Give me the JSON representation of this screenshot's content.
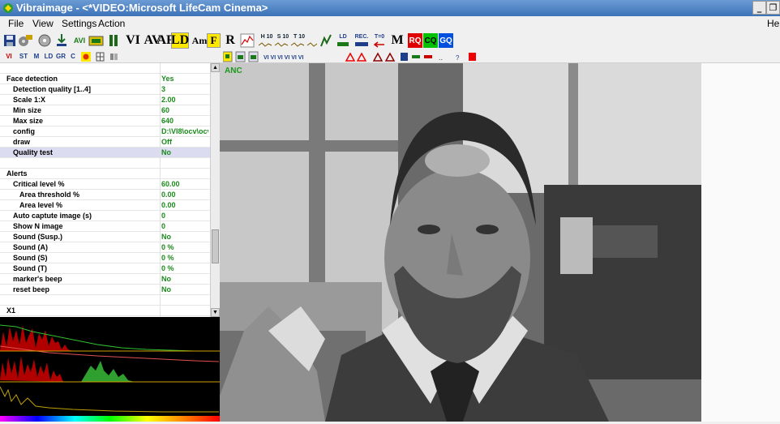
{
  "window": {
    "title": "Vibraimage - <*VIDEO:Microsoft LifeCam Cinema>",
    "minimize_glyph": "_",
    "restore_glyph": "❐"
  },
  "menu": {
    "items": [
      "File",
      "View",
      "Settings",
      "Action"
    ],
    "help": "Hel"
  },
  "toolbar1": {
    "avi": "AVI",
    "vi": "VI",
    "av": "AV",
    "ar": "AR",
    "ld": "LD",
    "am": "Am",
    "f": "F",
    "r": "R",
    "h10": "H 10",
    "s10": "S 10",
    "t10": "T 10",
    "ld_small": "LD",
    "rec": "REC.",
    "t0": "T=0",
    "m": "M",
    "rq": "RQ",
    "cq": "CQ",
    "gq": "GQ"
  },
  "toolbar2": {
    "vi": "VI",
    "st": "ST",
    "m": "M",
    "ld": "LD",
    "gr": "GR",
    "c": "C"
  },
  "settings": {
    "rows": [
      {
        "name": "",
        "value": "",
        "indent": 0
      },
      {
        "name": "Face detection",
        "value": "Yes",
        "indent": 0
      },
      {
        "name": "Detection quality [1..4]",
        "value": "3",
        "indent": 1
      },
      {
        "name": "Scale 1:X",
        "value": "2.00",
        "indent": 1
      },
      {
        "name": "Min size",
        "value": "60",
        "indent": 1
      },
      {
        "name": "Max size",
        "value": "640",
        "indent": 1
      },
      {
        "name": "config",
        "value": "D:\\VI8\\ocv\\ocv_",
        "indent": 1
      },
      {
        "name": "draw",
        "value": "Off",
        "indent": 1
      },
      {
        "name": "Quality test",
        "value": "No",
        "indent": 1,
        "selected": true
      },
      {
        "name": "",
        "value": "",
        "indent": 0
      },
      {
        "name": "Alerts",
        "value": "",
        "indent": 0
      },
      {
        "name": "Critical level %",
        "value": "60.00",
        "indent": 1
      },
      {
        "name": "Area threshold %",
        "value": "0.00",
        "indent": 2
      },
      {
        "name": "Area level %",
        "value": "0.00",
        "indent": 2
      },
      {
        "name": "Auto captute image (s)",
        "value": "0",
        "indent": 1
      },
      {
        "name": "Show N image",
        "value": "0",
        "indent": 1
      },
      {
        "name": "Sound (Susp.)",
        "value": "No",
        "indent": 1
      },
      {
        "name": "Sound (A)",
        "value": "0 %",
        "indent": 1
      },
      {
        "name": "Sound (S)",
        "value": "0 %",
        "indent": 1
      },
      {
        "name": "Sound (T)",
        "value": "0 %",
        "indent": 1
      },
      {
        "name": "marker's beep",
        "value": "No",
        "indent": 1
      },
      {
        "name": "reset beep",
        "value": "No",
        "indent": 1
      },
      {
        "name": "",
        "value": "",
        "indent": 0
      },
      {
        "name": "X1",
        "value": "",
        "indent": 0
      },
      {
        "name": "",
        "value": "",
        "indent": 0
      }
    ]
  },
  "video": {
    "overlay_label": "ANC"
  },
  "colors": {
    "value_green": "#1a8a1a",
    "title_blue": "#3d72b8",
    "selected_row": "#dcdcf0"
  }
}
